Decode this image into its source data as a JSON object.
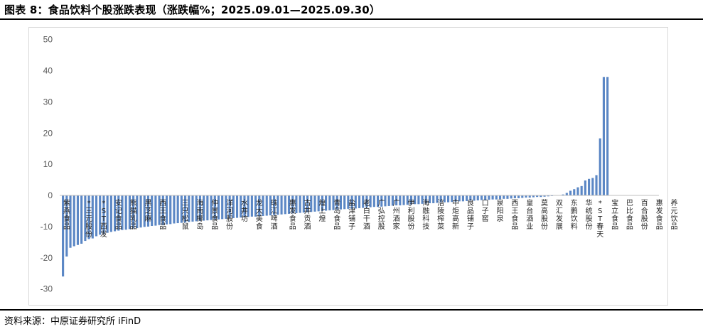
{
  "header": {
    "title": "图表 8：食品饮料个股涨跌表现（涨跌幅%；2025.09.01—2025.09.30）"
  },
  "footer": {
    "source": "资料来源：中原证券研究所   iFinD"
  },
  "chart_data": {
    "type": "bar",
    "title": "",
    "xlabel": "",
    "ylabel": "",
    "ylim": [
      -30,
      50
    ],
    "yticks": [
      50,
      40,
      30,
      20,
      10,
      0,
      -10,
      -20,
      -30
    ],
    "grid": false,
    "legend": "none",
    "bar_color": "#5b87c5",
    "labeled_indices": [
      1,
      7,
      11,
      15,
      19,
      23,
      27,
      33,
      37,
      41,
      45,
      49,
      53,
      57,
      62,
      66,
      70,
      74,
      78,
      82,
      86,
      90,
      94,
      98,
      102,
      106,
      110,
      114,
      118,
      122,
      126,
      130,
      134,
      138,
      142,
      145,
      149,
      153,
      157,
      161
    ],
    "categories": [
      "",
      "紫燕食品",
      "",
      "",
      "",
      "",
      "",
      "*三元股份",
      "",
      "",
      "",
      "*ST西发",
      "",
      "",
      "",
      "安记食品",
      "",
      "",
      "",
      "熊猫乳品",
      "",
      "",
      "",
      "黑芝麻",
      "",
      "",
      "",
      "西王食品",
      "",
      "",
      "",
      "",
      "",
      "三只松鼠",
      "",
      "",
      "",
      "海南椰岛",
      "",
      "",
      "",
      "仲景食品",
      "",
      "",
      "",
      "洋河股份",
      "",
      "",
      "",
      "水井坊",
      "",
      "",
      "",
      "龙大美食",
      "",
      "",
      "",
      "珠江啤酒",
      "",
      "",
      "",
      "",
      "惠发食品",
      "",
      "",
      "",
      "古井贡酒",
      "",
      "",
      "",
      "煌上煌",
      "",
      "",
      "",
      "青岛食品",
      "",
      "",
      "",
      "盐津铺子",
      "",
      "",
      "",
      "老白干酒",
      "",
      "",
      "",
      "广弘控股",
      "",
      "",
      "",
      "广州酒家",
      "",
      "",
      "",
      "伊利股份",
      "",
      "",
      "",
      "海融科技",
      "",
      "",
      "",
      "涪陵榨菜",
      "",
      "",
      "",
      "中炬高新",
      "",
      "",
      "",
      "良品铺子",
      "",
      "",
      "",
      "口子窖",
      "",
      "",
      "",
      "泉阳泉",
      "",
      "",
      "",
      "西王食品",
      "",
      "",
      "",
      "皇台酒业",
      "",
      "",
      "",
      "莫高股份",
      "",
      "",
      "",
      "双汇发展",
      "",
      "",
      "",
      "东鹏饮料",
      "",
      "",
      "",
      "华统股份",
      "",
      "",
      "*ST春天",
      "",
      "",
      "",
      "宝立食品",
      "",
      "",
      "",
      "巴比食品",
      "",
      "",
      "",
      "百合股份",
      "",
      "",
      "",
      "惠发食品",
      "",
      "",
      "",
      "养元饮品",
      ""
    ],
    "values": [
      -26.0,
      -19.6,
      -16.8,
      -16.3,
      -15.9,
      -15.5,
      -14.6,
      -14.0,
      -13.8,
      -13.1,
      -12.6,
      -12.4,
      -12.0,
      -11.7,
      -11.5,
      -11.3,
      -11.1,
      -11.0,
      -10.8,
      -10.6,
      -10.5,
      -10.3,
      -10.1,
      -10.0,
      -9.8,
      -9.7,
      -9.5,
      -9.4,
      -9.3,
      -9.2,
      -9.0,
      -8.9,
      -8.8,
      -8.7,
      -8.5,
      -8.4,
      -8.3,
      -8.2,
      -8.1,
      -8.0,
      -7.9,
      -7.8,
      -7.7,
      -7.6,
      -7.5,
      -7.4,
      -7.3,
      -7.2,
      -7.1,
      -7.0,
      -6.9,
      -6.8,
      -6.8,
      -6.7,
      -6.6,
      -6.5,
      -6.4,
      -6.3,
      -6.2,
      -6.1,
      -6.0,
      -5.9,
      -5.8,
      -5.7,
      -5.6,
      -5.5,
      -5.4,
      -5.3,
      -5.2,
      -5.1,
      -5.0,
      -4.9,
      -4.8,
      -4.7,
      -4.6,
      -4.5,
      -4.4,
      -4.3,
      -4.3,
      -4.2,
      -4.1,
      -4.0,
      -3.9,
      -3.8,
      -3.7,
      -3.7,
      -3.6,
      -3.5,
      -3.4,
      -3.3,
      -3.2,
      -3.2,
      -3.1,
      -3.0,
      -2.9,
      -2.8,
      -2.8,
      -2.7,
      -2.6,
      -2.5,
      -2.5,
      -2.4,
      -2.3,
      -2.2,
      -2.2,
      -2.1,
      -2.0,
      -1.9,
      -1.9,
      -1.8,
      -1.7,
      -1.7,
      -1.6,
      -1.5,
      -1.5,
      -1.4,
      -1.3,
      -1.3,
      -1.2,
      -1.1,
      -1.1,
      -1.0,
      -0.9,
      -0.9,
      -0.8,
      -0.7,
      -0.7,
      -0.6,
      -0.5,
      -0.5,
      -0.4,
      -0.3,
      -0.2,
      -0.1,
      0.1,
      0.3,
      0.8,
      1.5,
      2.0,
      2.6,
      3.0,
      4.8,
      5.3,
      5.6,
      6.5,
      18.3,
      38.0,
      38.0,
      0,
      0,
      0,
      0,
      0,
      0,
      0,
      0,
      0,
      0,
      0,
      0,
      0
    ]
  }
}
